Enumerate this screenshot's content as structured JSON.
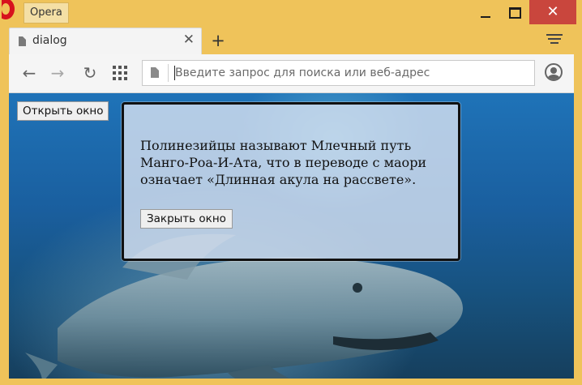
{
  "window": {
    "app_name": "Opera",
    "controls": {
      "minimize_icon": "minimize-icon",
      "maximize_icon": "maximize-icon",
      "close_icon": "close-icon",
      "close_glyph": "✕"
    }
  },
  "tabs": [
    {
      "title": "dialog",
      "icon": "document-icon",
      "close_glyph": "✕"
    }
  ],
  "new_tab_glyph": "+",
  "toolbar": {
    "back_glyph": "←",
    "forward_glyph": "→",
    "reload_glyph": "↻",
    "address": {
      "value": "",
      "placeholder": "Введите запрос для поиска или веб-адрес"
    }
  },
  "page": {
    "open_button_label": "Открыть окно",
    "dialog": {
      "text": "Полинезийцы называют Млечный путь Манго-Роа-И-Ата, что в переводе с маори означает «Длинная акула на рассвете».",
      "close_button_label": "Закрыть окно"
    }
  },
  "colors": {
    "frame": "#efc35a",
    "close_button": "#c9463d",
    "opera_red": "#d7121d"
  }
}
